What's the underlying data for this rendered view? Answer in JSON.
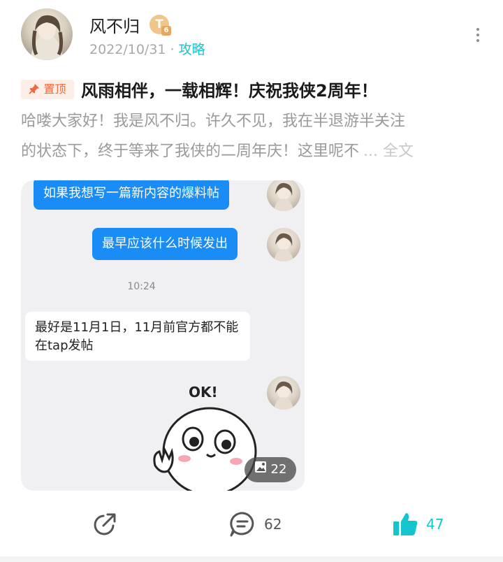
{
  "author": {
    "name": "风不归",
    "level_badge": "T",
    "level_sub": "6",
    "date": "2022/10/31",
    "separator": "·",
    "category": "攻略"
  },
  "post": {
    "pin_label": "置顶",
    "title": "风雨相伴，一载相辉！庆祝我侠2周年！",
    "body_line1": "哈喽大家好！我是风不归。许久不见，我在半退游半关注",
    "body_line2": "的状态下，终于等来了我侠的二周年庆！这里呢不",
    "ellipsis": "...",
    "full_text_link": "全文"
  },
  "image": {
    "bubble1": "如果我想写一篇新内容的爆料帖",
    "bubble2": "最早应该什么时候发出",
    "time": "10:24",
    "reply": "最好是11月1日，11月前官方都不能在tap发帖",
    "sticker_text": "OK!",
    "image_count": "22"
  },
  "actions": {
    "comments": "62",
    "likes": "47"
  },
  "colors": {
    "accent": "#15c5ce",
    "pin": "#f06a3f",
    "bubble_blue": "#1a8cf5"
  }
}
